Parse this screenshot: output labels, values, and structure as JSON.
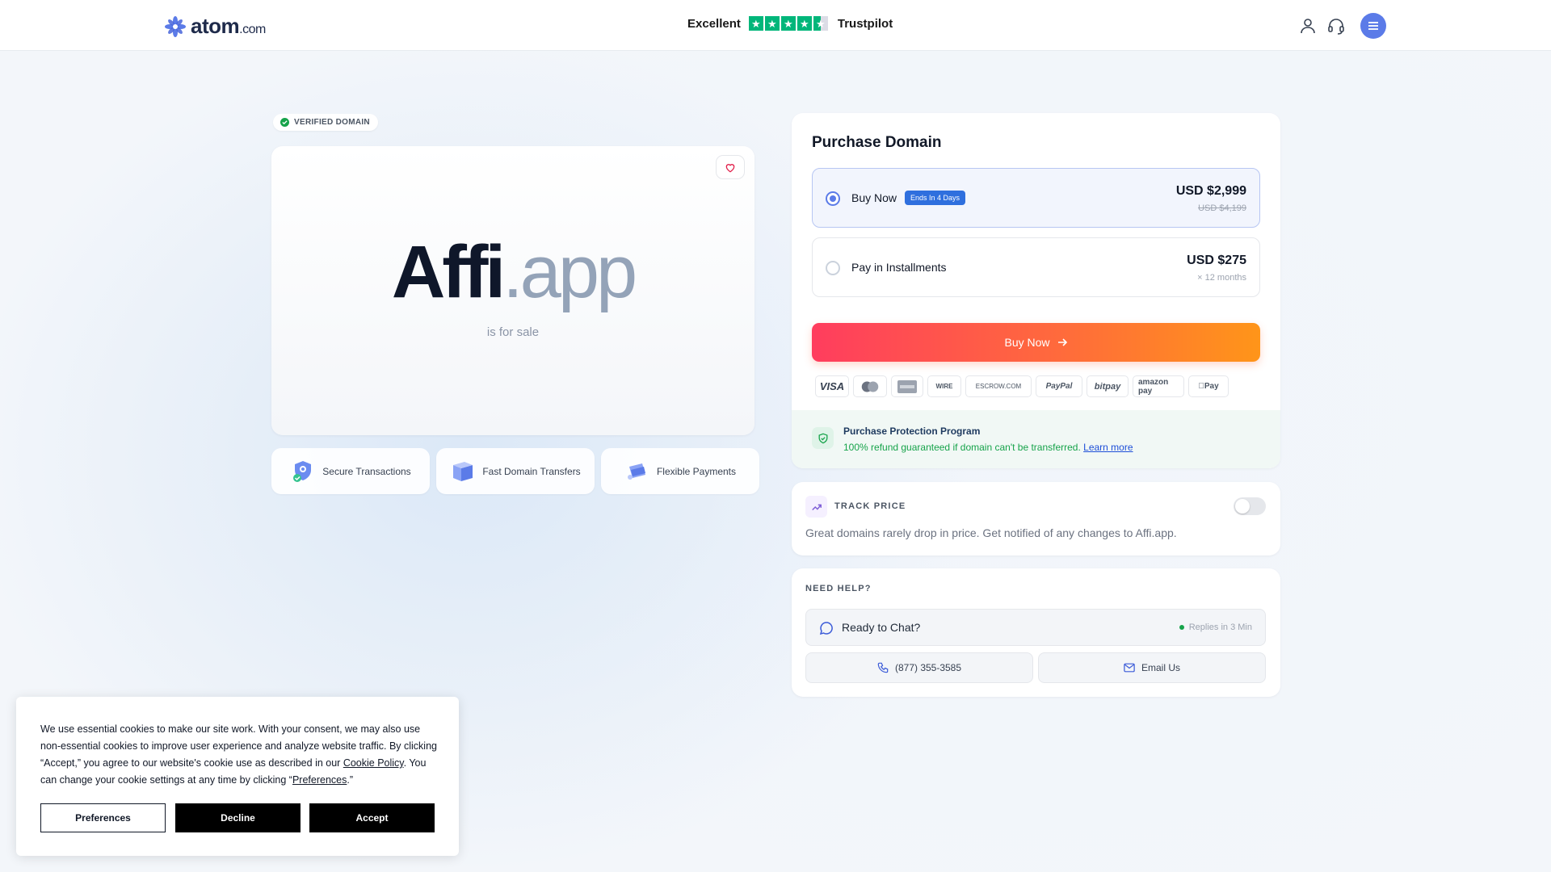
{
  "header": {
    "logo": {
      "name": "atom",
      "suffix": ".com"
    },
    "trustpilot": {
      "rating_label": "Excellent",
      "brand": "Trustpilot",
      "stars": 4.5
    }
  },
  "verified_badge": "VERIFIED DOMAIN",
  "domain": {
    "base": "Affi",
    "ext": ".app",
    "subtitle": "is for sale"
  },
  "features": [
    {
      "label": "Secure Transactions",
      "icon": "shield-lock-icon"
    },
    {
      "label": "Fast Domain Transfers",
      "icon": "transfer-cube-icon"
    },
    {
      "label": "Flexible Payments",
      "icon": "payment-tag-icon"
    }
  ],
  "purchase": {
    "title": "Purchase Domain",
    "options": [
      {
        "label": "Buy Now",
        "badge": "Ends In 4 Days",
        "price": "USD $2,999",
        "original_price": "USD $4,199",
        "selected": true
      },
      {
        "label": "Pay in Installments",
        "price": "USD $275",
        "detail": "× 12 months",
        "selected": false
      }
    ],
    "cta": "Buy Now",
    "payment_methods": [
      "VISA",
      "Mastercard",
      "American Express",
      "WIRE",
      "ESCROW.COM",
      "PayPal",
      "bitpay",
      "amazon pay",
      "Apple Pay"
    ],
    "protection": {
      "title": "Purchase Protection Program",
      "text": "100% refund guaranteed if domain can't be transferred.",
      "link": "Learn more"
    }
  },
  "track_price": {
    "label": "TRACK PRICE",
    "enabled": false,
    "text": "Great domains rarely drop in price. Get notified of any changes to Affi.app."
  },
  "help": {
    "label": "NEED HELP?",
    "chat": {
      "label": "Ready to Chat?",
      "status": "Replies in 3 Min"
    },
    "phone": "(877) 355-3585",
    "email": "Email Us"
  },
  "cookie": {
    "text_1": "We use essential cookies to make our site work. With your consent, we may also use non-essential cookies to improve user experience and analyze website traffic. By clicking “Accept,” you agree to our website's cookie use as described in our ",
    "link_policy": "Cookie Policy",
    "text_2": ". You can change your cookie settings at any time by clicking “",
    "link_prefs": "Preferences",
    "text_3": ".”",
    "buttons": {
      "preferences": "Preferences",
      "decline": "Decline",
      "accept": "Accept"
    }
  },
  "colors": {
    "accent": "#5b7be8",
    "cta_start": "#ff3d5e",
    "cta_end": "#ff9519",
    "success": "#16a34a",
    "trustpilot": "#00b67a"
  }
}
